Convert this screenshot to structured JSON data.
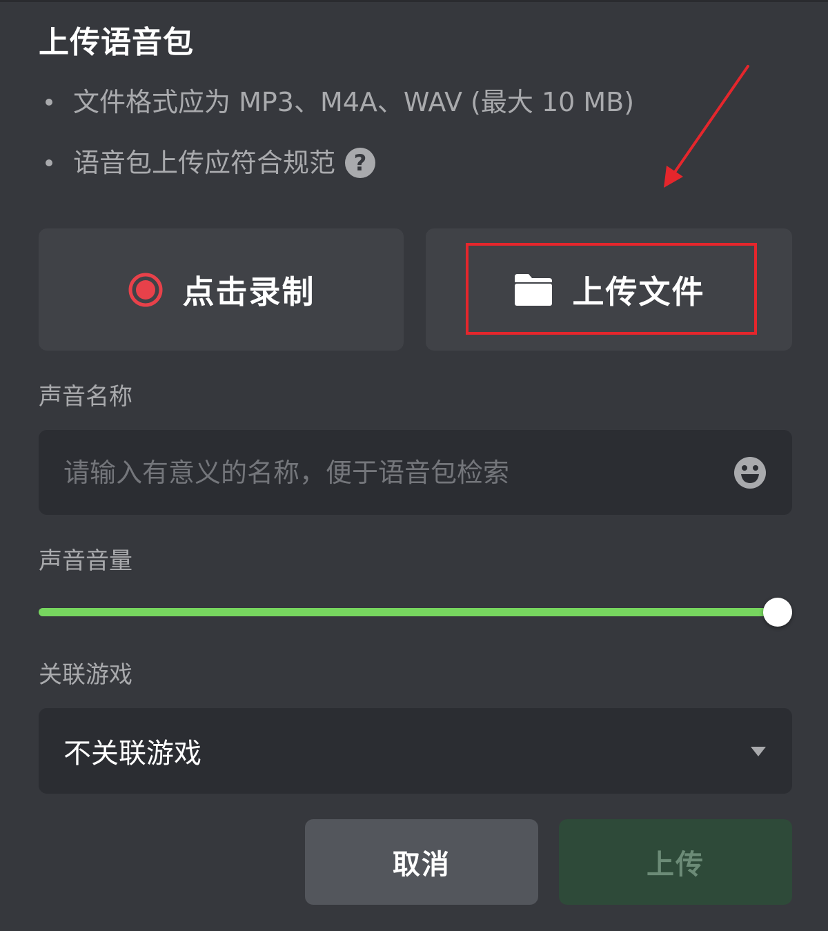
{
  "dialog": {
    "title": "上传语音包",
    "notes": [
      "文件格式应为 MP3、M4A、WAV (最大 10 MB)",
      "语音包上传应符合规范"
    ],
    "help_icon": "question-circle-icon"
  },
  "actions": {
    "record_label": "点击录制",
    "record_icon": "record-icon",
    "upload_label": "上传文件",
    "upload_icon": "folder-icon"
  },
  "name_field": {
    "label": "声音名称",
    "placeholder": "请输入有意义的名称，便于语音包检索",
    "value": "",
    "emoji_icon": "emoji-icon"
  },
  "volume": {
    "label": "声音音量",
    "value_fraction": 1.0
  },
  "game_field": {
    "label": "关联游戏",
    "selected": "不关联游戏",
    "caret_icon": "caret-down-icon"
  },
  "buttons": {
    "cancel": "取消",
    "upload": "上传"
  },
  "colors": {
    "background": "#36383d",
    "card": "#404247",
    "input": "#2b2d32",
    "accent_green": "#77d65f",
    "record_red": "#e8414a",
    "highlight_red": "#e5262c",
    "upload_button": "#2e4a39"
  }
}
